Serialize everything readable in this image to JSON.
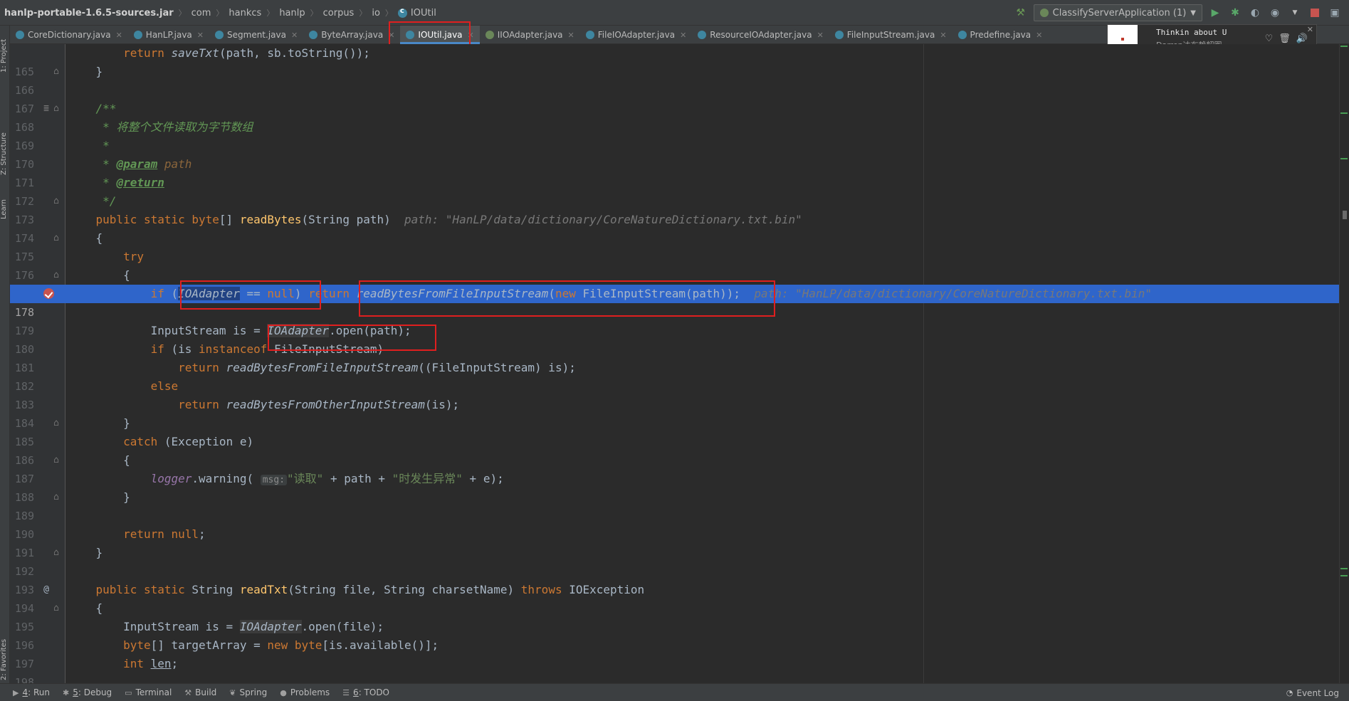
{
  "breadcrumb": {
    "jar": "hanlp-portable-1.6.5-sources.jar",
    "parts": [
      "com",
      "hankcs",
      "hanlp",
      "corpus",
      "io"
    ],
    "file": "IOUtil"
  },
  "run_config": "ClassifyServerApplication (1)",
  "tabs": [
    {
      "label": "CoreDictionary.java",
      "icon": "class-icon"
    },
    {
      "label": "HanLP.java",
      "icon": "class-icon"
    },
    {
      "label": "Segment.java",
      "icon": "class-icon"
    },
    {
      "label": "ByteArray.java",
      "icon": "class-icon"
    },
    {
      "label": "IOUtil.java",
      "icon": "class-icon",
      "active": true
    },
    {
      "label": "IIOAdapter.java",
      "icon": "interface-icon"
    },
    {
      "label": "FileIOAdapter.java",
      "icon": "class-icon"
    },
    {
      "label": "ResourceIOAdapter.java",
      "icon": "class-icon"
    },
    {
      "label": "FileInputStream.java",
      "icon": "class-icon"
    },
    {
      "label": "Predefine.java",
      "icon": "class-icon"
    }
  ],
  "player": {
    "title": "Thinkin  about  U",
    "artist": "Darren达布赖韶图"
  },
  "left_tools": [
    "1: Project",
    "Z: Structure",
    "Learn",
    "2: Favorites"
  ],
  "code": {
    "lines": [
      {
        "n": "165",
        "t": "        return saveTxt(path, sb.toString());"
      },
      {
        "n": "166",
        "t": "    }"
      },
      {
        "n": "167",
        "t": ""
      },
      {
        "n": "168",
        "t": "    /**"
      },
      {
        "n": "169",
        "t": "     * 将整个文件读取为字节数组"
      },
      {
        "n": "170",
        "t": "     *"
      },
      {
        "n": "171",
        "t": "     * @param path"
      },
      {
        "n": "172",
        "t": "     * @return"
      },
      {
        "n": "173",
        "t": "     */"
      },
      {
        "n": "174",
        "t": "    public static byte[] readBytes(String path)"
      },
      {
        "n": "175",
        "t": "    {"
      },
      {
        "n": "176",
        "t": "        try"
      },
      {
        "n": "177",
        "t": "        {"
      },
      {
        "n": "178",
        "t": "            if (IOAdapter == null) return readBytesFromFileInputStream(new FileInputStream(path));"
      },
      {
        "n": "179",
        "t": ""
      },
      {
        "n": "180",
        "t": "            InputStream is = IOAdapter.open(path);"
      },
      {
        "n": "181",
        "t": "            if (is instanceof FileInputStream)"
      },
      {
        "n": "182",
        "t": "                return readBytesFromFileInputStream((FileInputStream) is);"
      },
      {
        "n": "183",
        "t": "            else"
      },
      {
        "n": "184",
        "t": "                return readBytesFromOtherInputStream(is);"
      },
      {
        "n": "185",
        "t": "        }"
      },
      {
        "n": "186",
        "t": "        catch (Exception e)"
      },
      {
        "n": "187",
        "t": "        {"
      },
      {
        "n": "188",
        "t": "            logger.warning(\"读取\" + path + \"时发生异常\" + e);"
      },
      {
        "n": "189",
        "t": "        }"
      },
      {
        "n": "190",
        "t": ""
      },
      {
        "n": "191",
        "t": "        return null;"
      },
      {
        "n": "192",
        "t": "    }"
      },
      {
        "n": "193",
        "t": ""
      },
      {
        "n": "194",
        "t": "    public static String readTxt(String file, String charsetName) throws IOException"
      },
      {
        "n": "195",
        "t": "    {"
      },
      {
        "n": "196",
        "t": "        InputStream is = IOAdapter.open(file);"
      },
      {
        "n": "197",
        "t": "        byte[] targetArray = new byte[is.available()];"
      },
      {
        "n": "198",
        "t": "        int len;"
      }
    ],
    "inlay_path": "path: \"HanLP/data/dictionary/CoreNatureDictionary.txt.bin\"",
    "hint_msg": "msg:",
    "current_line": "178"
  },
  "bottom_tools": [
    {
      "key": "4",
      "label": ": Run"
    },
    {
      "key": "5",
      "label": ": Debug"
    },
    {
      "key": "",
      "label": "Terminal"
    },
    {
      "key": "",
      "label": "Build"
    },
    {
      "key": "",
      "label": "Spring"
    },
    {
      "key": "",
      "label": "Problems"
    },
    {
      "key": "6",
      "label": ": TODO"
    }
  ],
  "event_log": "Event Log"
}
